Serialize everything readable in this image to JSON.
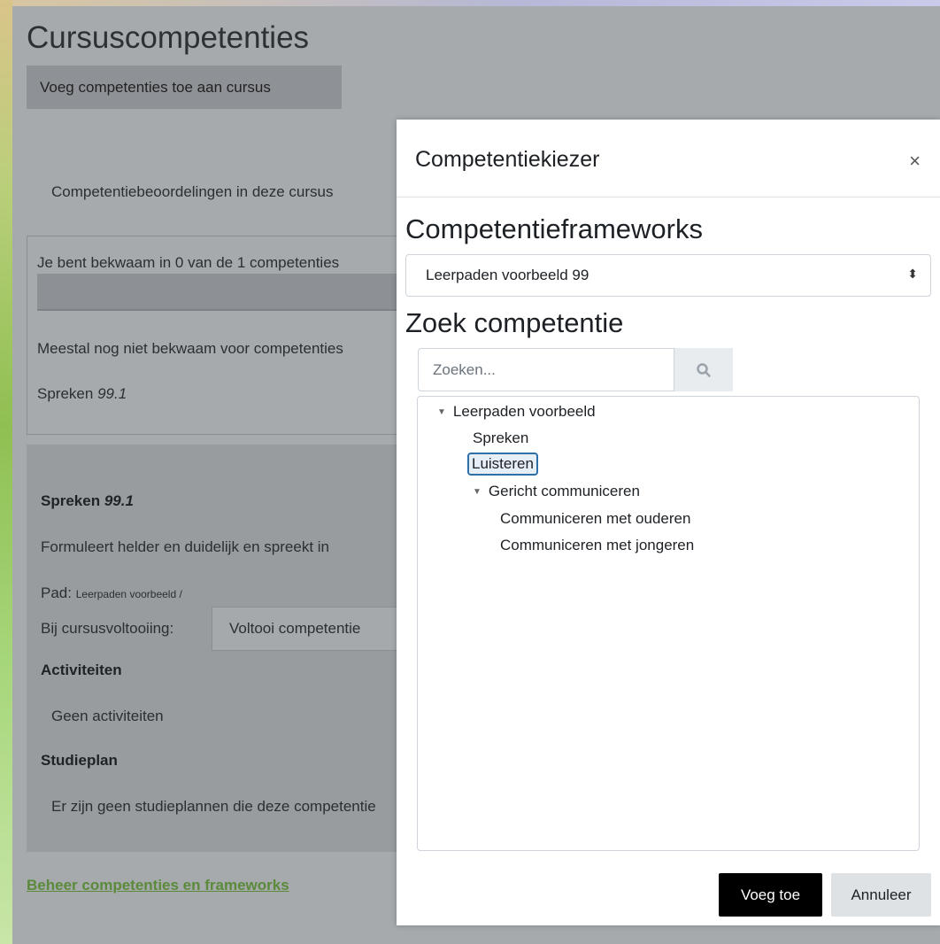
{
  "page": {
    "title": "Cursuscompetenties",
    "add_button": "Voeg competenties toe aan cursus",
    "overview_caption": "Competentiebeoordelingen in deze cursus",
    "summary": {
      "proficient_text": "Je bent bekwaam in 0 van de 1 competenties",
      "progress_fraction": 0,
      "mostly_not_text": "Meestal nog niet bekwaam voor competenties",
      "competency_name": "Spreken",
      "competency_id": "99.1"
    },
    "detail": {
      "title_name": "Spreken",
      "title_id": "99.1",
      "description": "Formuleert helder en duidelijk en spreekt in",
      "path_label": "Pad:",
      "path_value": "Leerpaden voorbeeld /",
      "completion_label": "Bij cursusvoltooiing:",
      "completion_value": "Voltooi competentie",
      "activities_heading": "Activiteiten",
      "activities_none": "Geen activiteiten",
      "plan_heading": "Studieplan",
      "plan_none": "Er zijn geen studieplannen die deze competentie"
    },
    "manage_link": "Beheer competenties en frameworks"
  },
  "dialog": {
    "title": "Competentiekiezer",
    "close_glyph": "×",
    "frameworks_heading": "Competentieframeworks",
    "framework_selected": "Leerpaden voorbeeld 99",
    "select_caret": "⬍",
    "search_heading": "Zoek competentie",
    "search_placeholder": "Zoeken...",
    "tree": {
      "root": "Leerpaden voorbeeld",
      "children": [
        "Spreken",
        "Luisteren"
      ],
      "group": "Gericht communiceren",
      "group_children": [
        "Communiceren met ouderen",
        "Communiceren met jongeren"
      ],
      "selected": "Luisteren"
    },
    "add_button": "Voeg toe",
    "cancel_button": "Annuleer"
  },
  "colors": {
    "overlay_gray": "#a6aaad",
    "selected_border": "#2f6fa8",
    "link_green": "#5a8a3a",
    "primary_button": "#000000"
  }
}
